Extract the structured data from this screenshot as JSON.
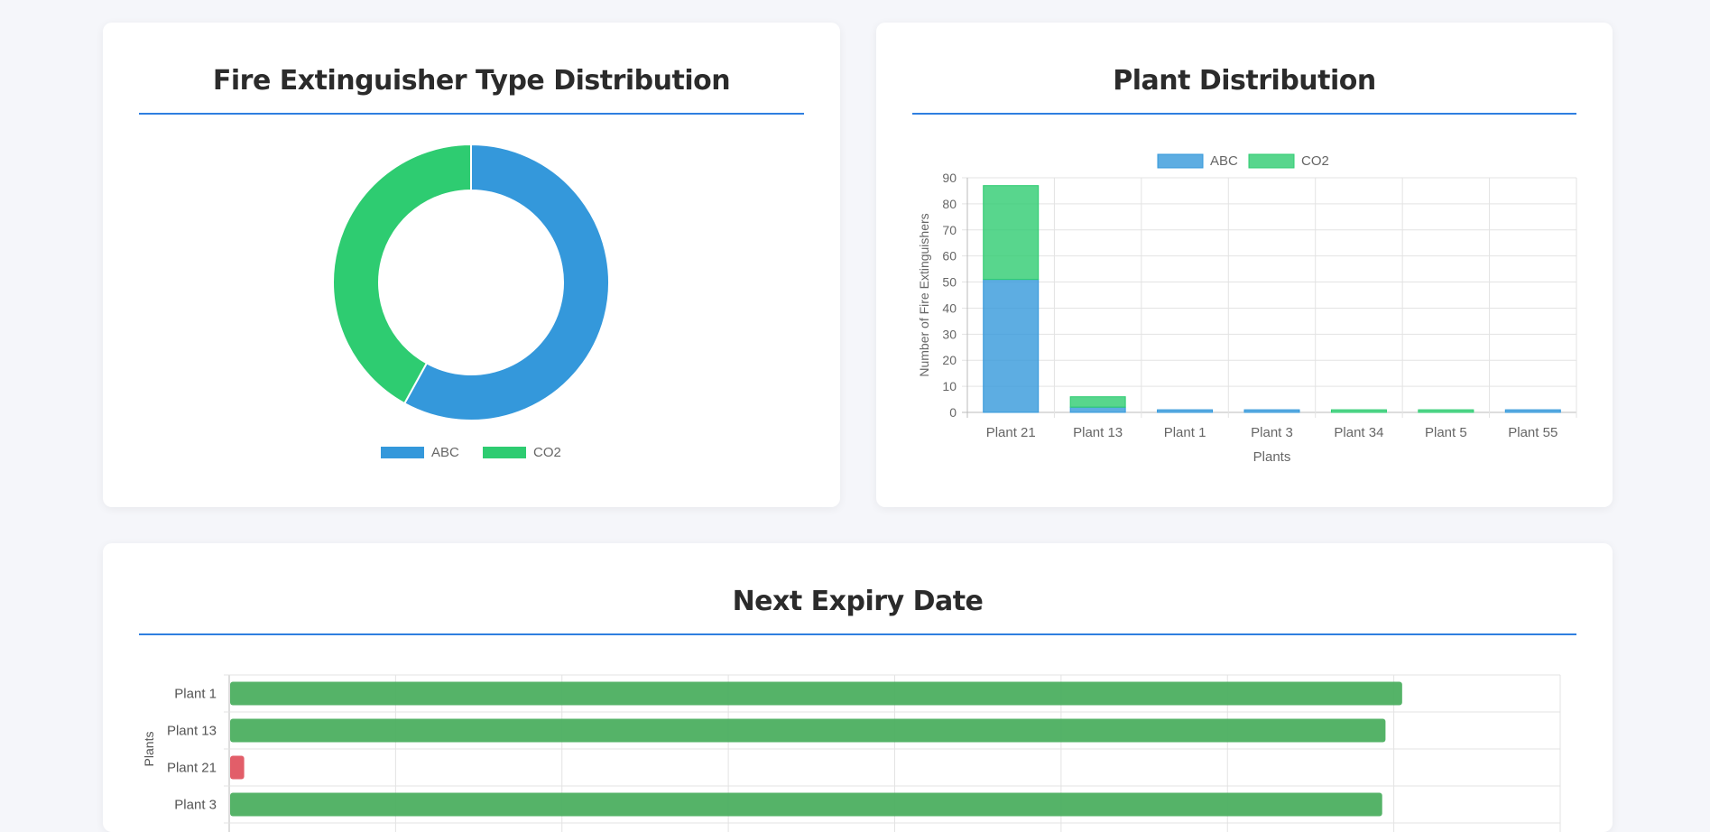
{
  "colors": {
    "abc": "#3498db",
    "co2": "#2ecc71",
    "ok": "#4caf60",
    "expired": "#e05561",
    "rule": "#2f7fe0"
  },
  "cards": {
    "type": {
      "title": "Fire Extinguisher Type Distribution"
    },
    "plant": {
      "title": "Plant Distribution"
    },
    "expiry": {
      "title": "Next Expiry Date"
    }
  },
  "chart_data": [
    {
      "type": "pie",
      "subtype": "doughnut",
      "labels": [
        "ABC",
        "CO2"
      ],
      "values": [
        58,
        42
      ],
      "legend": "bottom"
    },
    {
      "type": "bar",
      "stacked": true,
      "categories": [
        "Plant 21",
        "Plant 13",
        "Plant 1",
        "Plant 3",
        "Plant 34",
        "Plant 5",
        "Plant 55"
      ],
      "series": [
        {
          "name": "ABC",
          "values": [
            51,
            2,
            1,
            1,
            0,
            0,
            1
          ]
        },
        {
          "name": "CO2",
          "values": [
            36,
            4,
            0,
            0,
            1,
            1,
            0
          ]
        }
      ],
      "xlabel": "Plants",
      "ylabel": "Number of Fire Extinguishers",
      "ylim": [
        0,
        90
      ],
      "yticks": [
        0,
        10,
        20,
        30,
        40,
        50,
        60,
        70,
        80,
        90
      ],
      "legend": "top",
      "grid": true
    },
    {
      "type": "bar",
      "orientation": "horizontal",
      "categories": [
        "Plant 1",
        "Plant 13",
        "Plant 21",
        "Plant 3"
      ],
      "values": [
        705,
        695,
        9,
        693
      ],
      "status": [
        "ok",
        "ok",
        "expired",
        "ok"
      ],
      "xlim": [
        0,
        800
      ],
      "ylabel": "Plants",
      "grid": true
    }
  ]
}
